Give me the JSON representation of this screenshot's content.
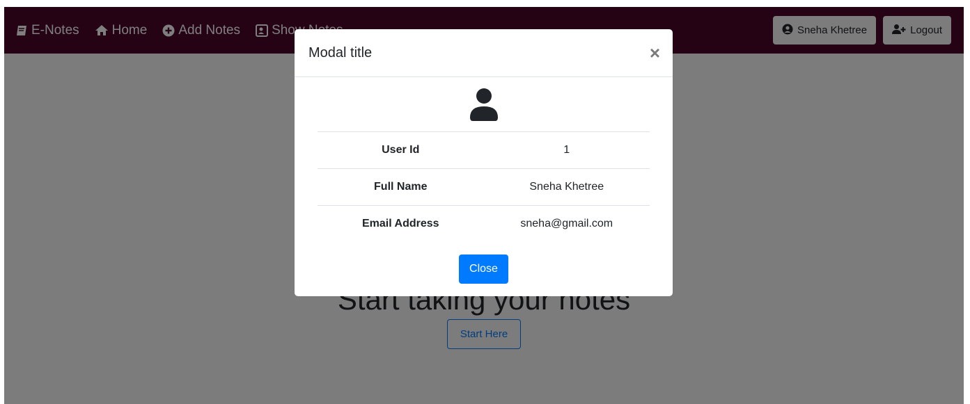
{
  "navbar": {
    "brand": "E-Notes",
    "links": [
      {
        "label": "Home",
        "icon": "home-icon"
      },
      {
        "label": "Add Notes",
        "icon": "plus-circle-icon"
      },
      {
        "label": "Show Notes",
        "icon": "address-card-icon"
      }
    ],
    "user_button": "Sneha Khetree",
    "logout_button": "Logout"
  },
  "hero": {
    "title": "Start taking your notes",
    "start_button": "Start Here"
  },
  "modal": {
    "title": "Modal title",
    "close_x": "×",
    "rows": [
      {
        "key": "User Id",
        "value": "1"
      },
      {
        "key": "Full Name",
        "value": "Sneha Khetree"
      },
      {
        "key": "Email Address",
        "value": "sneha@gmail.com"
      }
    ],
    "close_button": "Close"
  },
  "colors": {
    "navbar": "#4a0628",
    "primary": "#007bff",
    "backdrop": "rgba(0,0,0,0.5)"
  }
}
